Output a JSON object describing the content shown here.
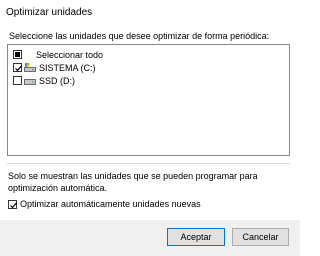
{
  "window": {
    "title": "Optimizar unidades"
  },
  "drives_list": {
    "label": "Seleccione las unidades que desee optimizar de forma periódica:",
    "select_all": {
      "label": "Seleccionar todo",
      "state": "indeterminate"
    },
    "items": [
      {
        "label": "SISTEMA (C:)",
        "checked": true,
        "icon": "system-drive-icon"
      },
      {
        "label": "SSD (D:)",
        "checked": false,
        "icon": "drive-icon"
      }
    ]
  },
  "note": "Solo se muestran las unidades que se pueden programar para optimización automática.",
  "auto_optimize": {
    "label": "Optimizar automáticamente unidades nuevas",
    "checked": true
  },
  "buttons": {
    "ok": "Aceptar",
    "cancel": "Cancelar"
  },
  "colors": {
    "accent": "#0078d7",
    "footer_bg": "#f0f0f0",
    "button_bg": "#e1e1e1"
  }
}
